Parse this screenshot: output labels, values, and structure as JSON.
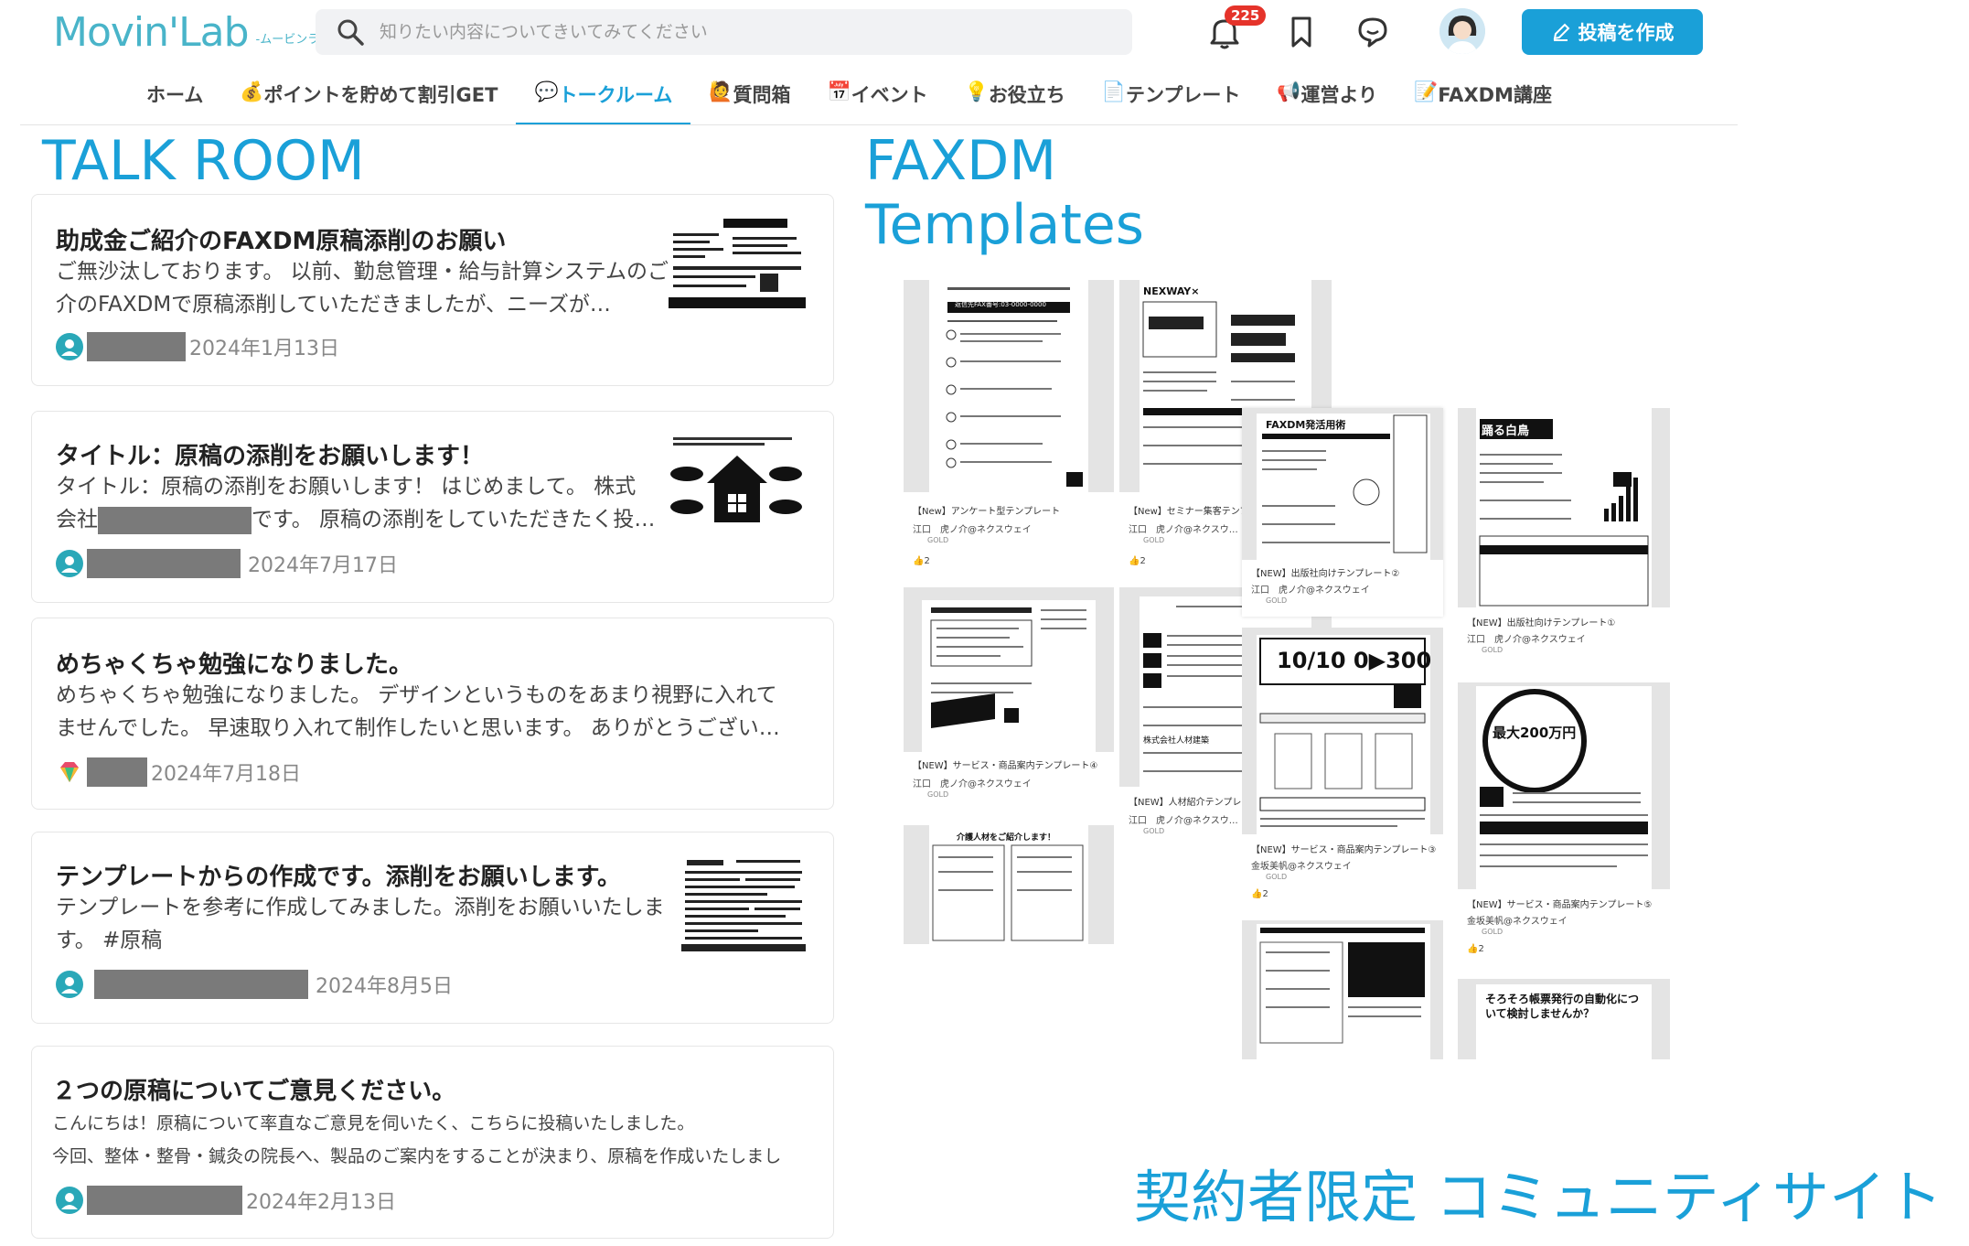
{
  "header": {
    "logo_main": "Movin'Lab",
    "logo_sub": "-ムービンラボ-",
    "search_placeholder": "知りたい内容についてきいてみてください",
    "notification_count": "225",
    "post_button": "投稿を作成",
    "accent_color": "#1aa0d8",
    "icons": [
      "search-icon",
      "bell-icon",
      "bookmark-icon",
      "chat-icon",
      "avatar",
      "pencil-icon"
    ]
  },
  "nav": {
    "items": [
      {
        "label": "ホーム",
        "icon": ""
      },
      {
        "label": "ポイントを貯めて割引GET",
        "icon": "💰"
      },
      {
        "label": "トークルーム",
        "icon": "💬"
      },
      {
        "label": "質問箱",
        "icon": "🙋"
      },
      {
        "label": "イベント",
        "icon": "📅"
      },
      {
        "label": "お役立ち",
        "icon": "💡"
      },
      {
        "label": "テンプレート",
        "icon": "📄"
      },
      {
        "label": "運営より",
        "icon": "📢"
      },
      {
        "label": "FAXDM講座",
        "icon": "📝"
      }
    ],
    "active_index": 2
  },
  "talkroom": {
    "title": "TALK ROOM",
    "posts": [
      {
        "title": "助成金ご紹介のFAXDM原稿添削のお願い",
        "body": "ご無沙汰しております。 以前、勤怠管理・給与計算システムのご紹介のFAXDMで原稿添削していただきましたが、ニーズが…",
        "date": "2024年1月13日"
      },
      {
        "title": "タイトル：原稿の添削をお願いします！",
        "body_line1": "タイトル：原稿の添削をお願いします！ はじめまして。 株式",
        "body_prefix": "会社",
        "body_suffix": "です。 原稿の添削をしていただきたく投…",
        "date": "2024年7月17日"
      },
      {
        "title": "めちゃくちゃ勉強になりました。",
        "body": "めちゃくちゃ勉強になりました。 デザインというものをあまり視野に入れてませんでした。 早速取り入れて制作したいと思います。 ありがとうござい…",
        "date": "2024年7月18日"
      },
      {
        "title": "テンプレートからの作成です。添削をお願いします。",
        "body": "テンプレートを参考に作成してみました。添削をお願いいたします。 #原稿",
        "date": "2024年8月5日"
      },
      {
        "title": "２つの原稿についてご意見ください。",
        "body_line1": "こんにちは！原稿について率直なご意見を伺いたく、こちらに投稿いたしました。",
        "body_line2": "今回、整体・整骨・鍼灸の院長へ、製品のご案内をすることが決まり、原稿を作成いたしまし",
        "date": "2024年2月13日"
      }
    ]
  },
  "templates": {
    "title_line1": "FAXDM",
    "title_line2": "Templates",
    "cards": [
      {
        "label": "【New】アンケート型テンプレート",
        "author": "江口　虎ノ介@ネクスウェイ",
        "rank": "GOLD",
        "likes": "2",
        "doc_text": "返信先FAX番号:03-0000-0000"
      },
      {
        "label": "【New】セミナー集客テンプ…",
        "author": "江口　虎ノ介@ネクスウ…",
        "rank": "GOLD",
        "likes": "2",
        "doc_text": "NEXWAY×"
      },
      {
        "label": "【NEW】出版社向けテンプレート②",
        "author": "江口　虎ノ介@ネクスウェイ",
        "rank": "GOLD",
        "likes": "",
        "doc_text": "FAXDM発活用術"
      },
      {
        "label": "【NEW】出版社向けテンプレート①",
        "author": "江口　虎ノ介@ネクスウェイ",
        "rank": "GOLD",
        "likes": "",
        "doc_text": "踊る白鳥"
      },
      {
        "label": "【NEW】サービス・商品案内テンプレート④",
        "author": "江口　虎ノ介@ネクスウェイ",
        "rank": "GOLD",
        "likes": "",
        "doc_text": ""
      },
      {
        "label": "【NEW】人材紹介テンプレ…",
        "author": "江口　虎ノ介@ネクスウ…",
        "rank": "GOLD",
        "likes": "",
        "doc_text": "株式会社人材建築"
      },
      {
        "label": "【NEW】サービス・商品案内テンプレート③",
        "author": "金坂美帆@ネクスウェイ",
        "rank": "GOLD",
        "likes": "2",
        "doc_text": "10/10 0▶300"
      },
      {
        "label": "【NEW】サービス・商品案内テンプレート⑤",
        "author": "金坂美帆@ネクスウェイ",
        "rank": "GOLD",
        "likes": "2",
        "doc_text": "最大200万円"
      },
      {
        "label": "",
        "author": "",
        "rank": "",
        "likes": "",
        "doc_text": "介護人材をご紹介します！"
      },
      {
        "label": "",
        "author": "",
        "rank": "",
        "likes": "",
        "doc_text": "そろそろ帳票発行の自動化について検討しませんか？"
      }
    ]
  },
  "tagline": "契約者限定 コミュニティサイト"
}
